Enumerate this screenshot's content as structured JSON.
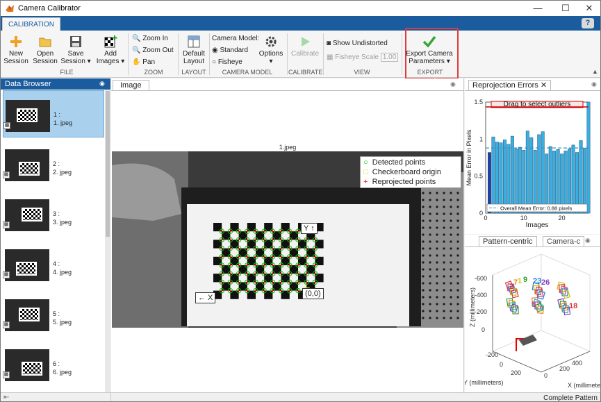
{
  "window": {
    "title": "Camera Calibrator",
    "minimize": "—",
    "maximize": "☐",
    "close": "✕"
  },
  "ribbon_tab": "CALIBRATION",
  "help": "?",
  "file_group": {
    "label": "FILE",
    "new_session": [
      "New",
      "Session"
    ],
    "open_session": [
      "Open",
      "Session"
    ],
    "save_session": [
      "Save",
      "Session ▾"
    ],
    "add_images": [
      "Add",
      "Images ▾"
    ]
  },
  "zoom_group": {
    "label": "ZOOM",
    "zoom_in": "Zoom In",
    "zoom_out": "Zoom Out",
    "pan": "Pan"
  },
  "layout_group": {
    "label": "LAYOUT",
    "default_layout": [
      "Default",
      "Layout"
    ]
  },
  "camera_model_group": {
    "label": "CAMERA MODEL",
    "heading": "Camera Model:",
    "standard": "Standard",
    "fisheye": "Fisheye",
    "options": [
      "Options",
      "▾"
    ]
  },
  "calibrate_group": {
    "label": "CALIBRATE",
    "calibrate": "Calibrate"
  },
  "view_group": {
    "label": "VIEW",
    "show_undistorted": "Show Undistorted",
    "fisheye_scale": "Fisheye Scale",
    "fisheye_scale_value": "1.00"
  },
  "export_group": {
    "label": "EXPORT",
    "export": [
      "Export Camera",
      "Parameters ▾"
    ]
  },
  "data_browser": {
    "title": "Data Browser",
    "items": [
      {
        "index": "1 :",
        "name": "1. jpeg"
      },
      {
        "index": "2 :",
        "name": "2. jpeg"
      },
      {
        "index": "3 :",
        "name": "3. jpeg"
      },
      {
        "index": "4 :",
        "name": "4. jpeg"
      },
      {
        "index": "5 :",
        "name": "5. jpeg"
      },
      {
        "index": "6 :",
        "name": "6. jpeg"
      }
    ],
    "selected": 0
  },
  "image_panel": {
    "tab": "Image",
    "title": "1.jpeg",
    "legend": [
      "Detected points",
      "Checkerboard origin",
      "Reprojected points"
    ],
    "origin_label": "(0,0)",
    "x_label": "← X",
    "y_label": "Y ↑"
  },
  "reprojection": {
    "tab": "Reprojection Errors",
    "drag_hint": "Drag to select outliers",
    "legend": "Overall Mean Error: 0.88 pixels"
  },
  "extrinsics": {
    "tabs": [
      "Pattern-centric",
      "Camera-c"
    ],
    "z_axis": "Z (millimeters)",
    "x_axis": "X (millimeters)",
    "y_axis": "Y (millimeters)",
    "z_ticks": [
      "-600",
      "-400",
      "-200",
      "0"
    ],
    "x_ticks": [
      "0",
      "200",
      "400"
    ],
    "y_ticks": [
      "-200",
      "0",
      "200"
    ],
    "labels": [
      "2",
      "7",
      "1",
      "9",
      "23",
      "26",
      "5",
      "3",
      "18"
    ]
  },
  "chart_data": {
    "type": "bar",
    "title": "",
    "xlabel": "Images",
    "ylabel": "Mean Error in Pixels",
    "ylim": [
      0,
      1.5
    ],
    "xlim": [
      0,
      27
    ],
    "xticks": [
      0,
      10,
      20
    ],
    "yticks": [
      0,
      0.5,
      1,
      1.5
    ],
    "mean_error": 0.88,
    "categories": [
      1,
      2,
      3,
      4,
      5,
      6,
      7,
      8,
      9,
      10,
      11,
      12,
      13,
      14,
      15,
      16,
      17,
      18,
      19,
      20,
      21,
      22,
      23,
      24,
      25,
      26,
      27
    ],
    "values": [
      0.82,
      1.03,
      0.96,
      0.95,
      0.99,
      0.93,
      1.04,
      0.87,
      0.89,
      0.85,
      1.11,
      1.02,
      0.85,
      1.06,
      1.1,
      0.8,
      0.9,
      0.84,
      0.86,
      0.8,
      0.84,
      0.87,
      0.92,
      0.82,
      0.98,
      0.88,
      1.5
    ],
    "selected_bar": 1,
    "grid": false,
    "legend_position": "bottom"
  },
  "status": "Complete Pattern",
  "colors": {
    "accent": "#1a5c9e",
    "bars": "#3aaee0",
    "selected_bar": "#1f3fa8",
    "highlight": "#e23a3a",
    "detected": "#00c000",
    "origin": "#e8e800",
    "reprojected": "#ff0000"
  }
}
